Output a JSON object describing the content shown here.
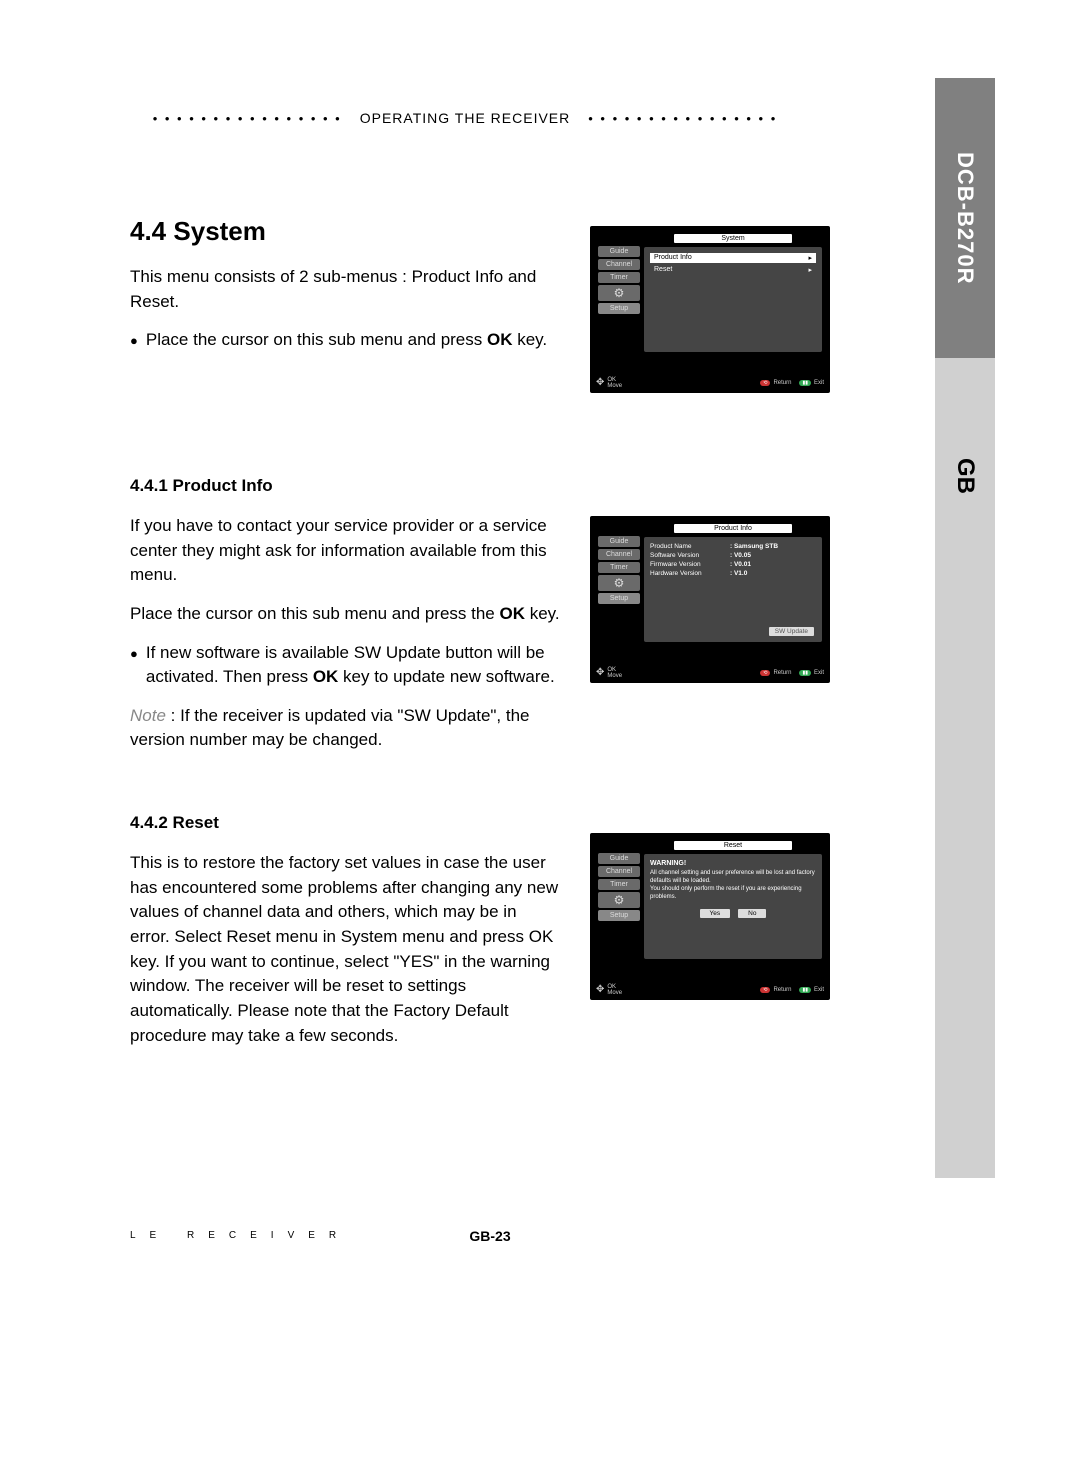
{
  "header": {
    "title": "OPERATING THE RECEIVER"
  },
  "sidebar": {
    "model": "DCB-B270R",
    "lang": "GB"
  },
  "sec_system": {
    "num": "4.4",
    "title": "System",
    "p1": "This menu consists of 2 sub-menus : Product Info and Reset.",
    "b1": "Place the cursor on this sub menu and press ",
    "b1_bold": "OK",
    "b1_tail": " key."
  },
  "sec_prod": {
    "num": "4.4.1",
    "title": "Product Info",
    "p1": "If you have to contact your service provider or a service center they might ask for information available from this menu.",
    "p2a": "Place the cursor on this sub menu and press the ",
    "p2_bold": "OK",
    "p2b": " key.",
    "b1a": "If new software is available SW Update button will be activated. Then press ",
    "b1_bold": "OK",
    "b1b": " key to update new software.",
    "note_label": "Note",
    "note_sep": " :  ",
    "note_body": "If the receiver is updated via \"SW Update\", the version number may be changed."
  },
  "sec_reset": {
    "num": "4.4.2",
    "title": "Reset",
    "p1": "This is to restore the factory set values in case the user has encountered some problems after changing any new values of channel data and others, which may be in error. Select Reset menu in System menu and press OK key. If you want to continue, select \"YES\" in the warning window. The receiver will be reset to settings automatically. Please note that the Factory Default procedure may take a few seconds."
  },
  "tv_menu": {
    "items": [
      "Guide",
      "Channel",
      "Timer"
    ],
    "setup": "Setup",
    "footer_ok": "OK",
    "footer_move": "Move",
    "footer_return": "Return",
    "footer_exit": "Exit"
  },
  "tv1": {
    "title": "System",
    "row1": "Product Info",
    "row2": "Reset"
  },
  "tv2": {
    "title": "Product Info",
    "rows": [
      {
        "lbl": "Product Name",
        "val": ": Samsung STB"
      },
      {
        "lbl": "Software Version",
        "val": ": V0.05"
      },
      {
        "lbl": "Firmware Version",
        "val": ": V0.01"
      },
      {
        "lbl": "Hardware Version",
        "val": ": V1.0"
      }
    ],
    "btn": "SW Update"
  },
  "tv3": {
    "title": "Reset",
    "warn_title": "WARNING!",
    "warn_body": "All channel setting and user preference will be lost and factory defaults will be loaded.\nYou should only perform the reset if you are experiencing problems.",
    "yes": "Yes",
    "no": "No"
  },
  "footer": {
    "left": "LE  RECEIVER",
    "page": "GB-23"
  }
}
